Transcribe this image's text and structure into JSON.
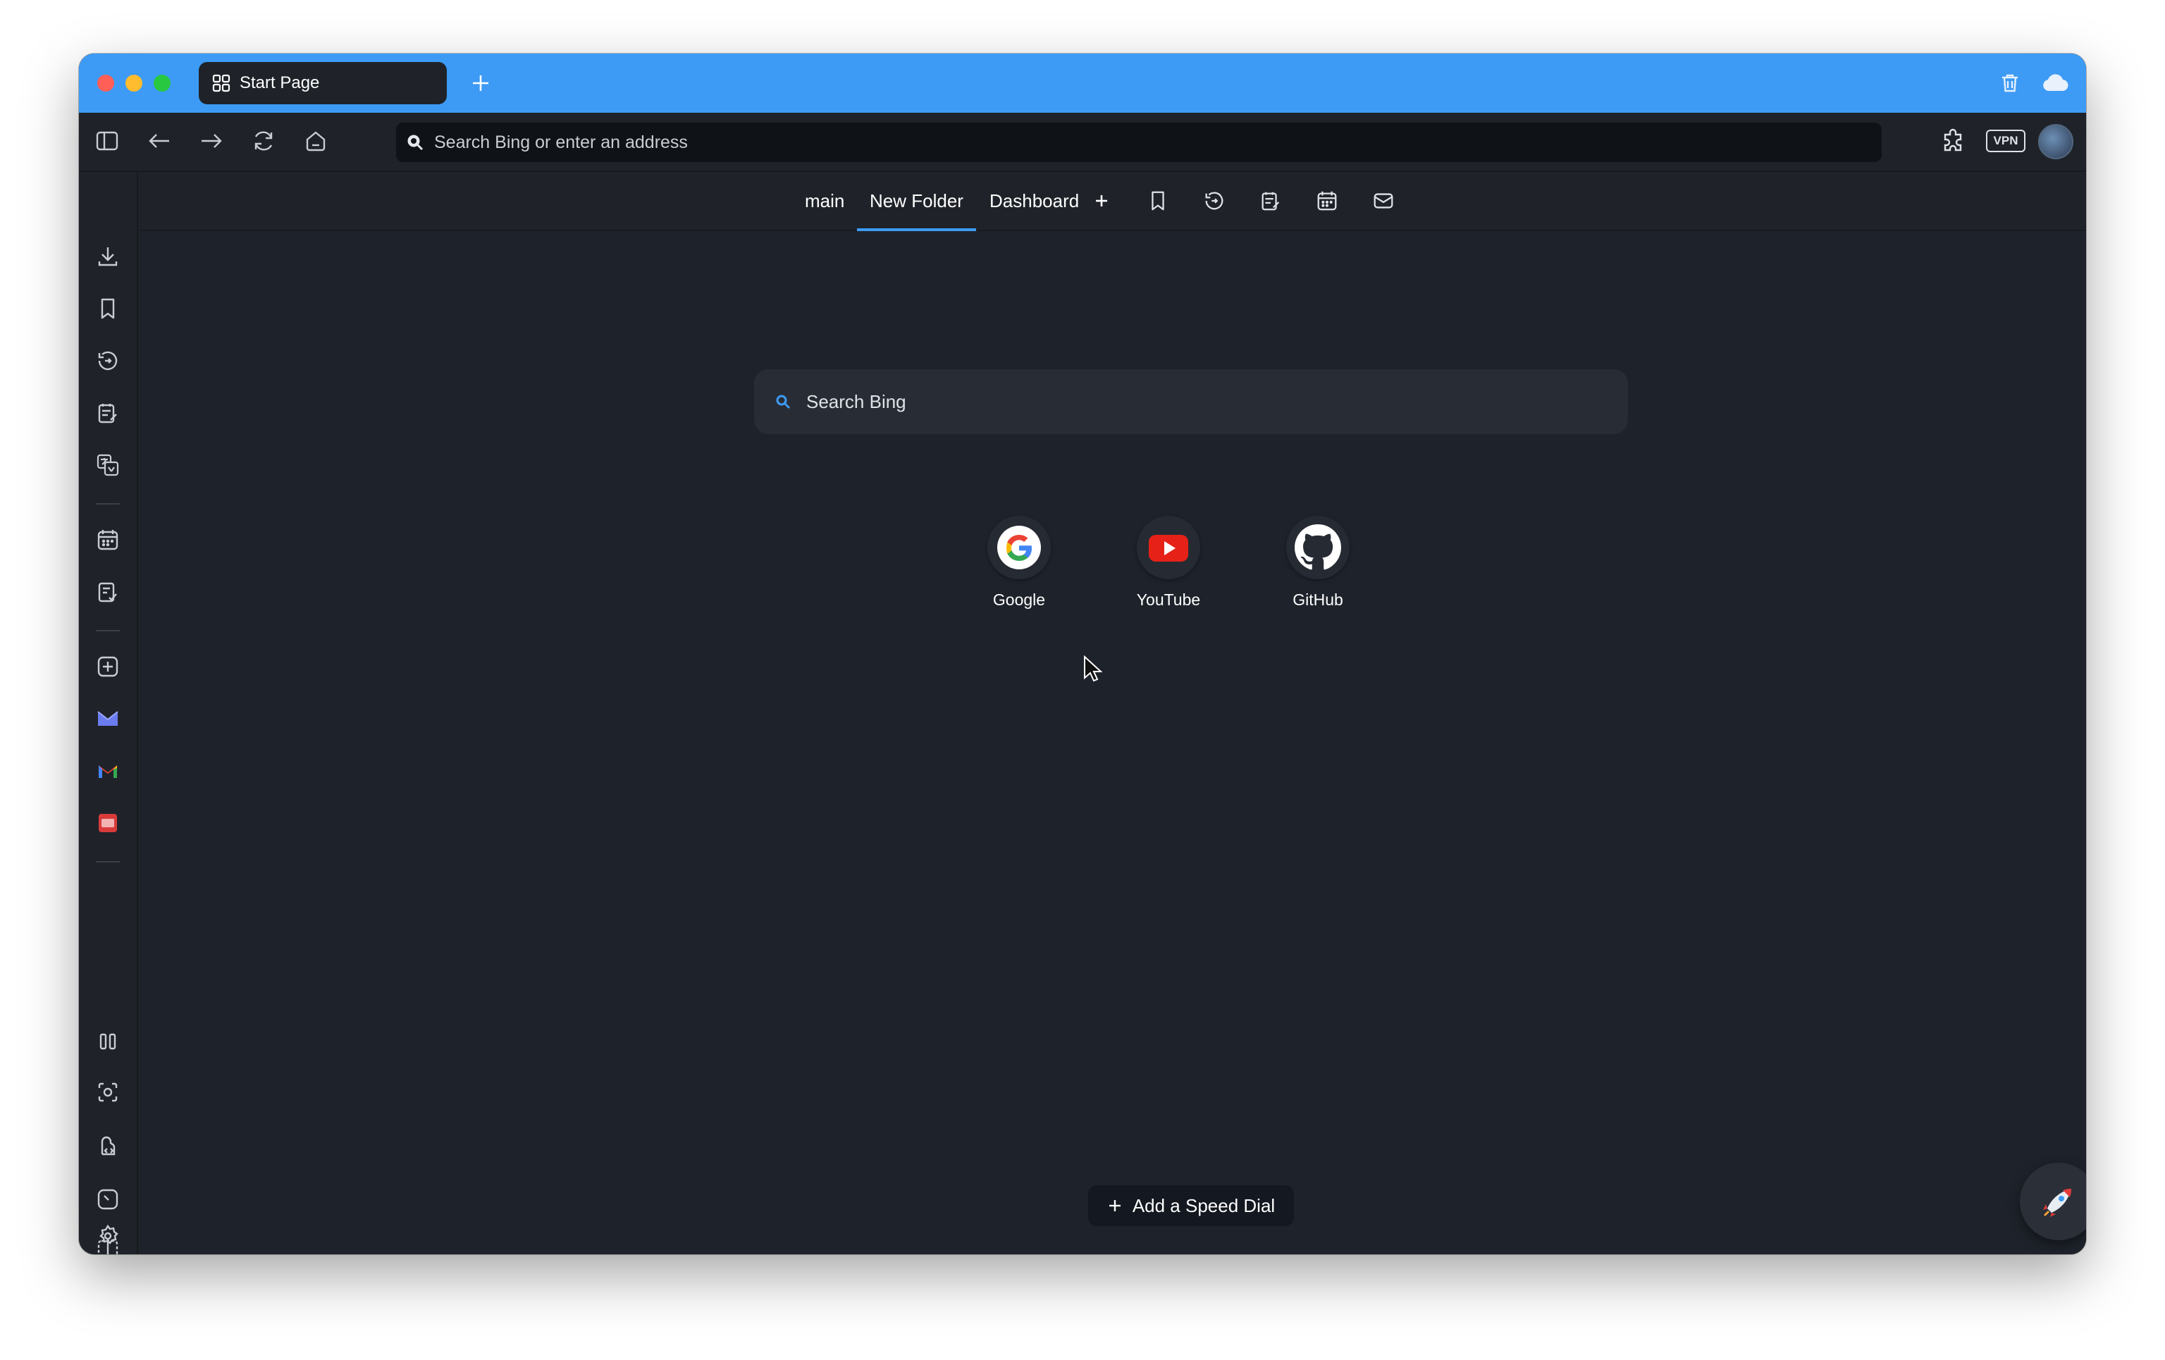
{
  "tab": {
    "title": "Start Page",
    "icon": "grid-icon"
  },
  "address_bar": {
    "placeholder": "Search Bing or enter an address",
    "icon": "search-icon"
  },
  "toolbar": {
    "left_icons": [
      "sidebar-toggle-icon",
      "back-icon",
      "forward-icon",
      "reload-icon",
      "home-icon"
    ],
    "right_icons": [
      "extensions-icon",
      "vpn-badge",
      "profile-avatar"
    ],
    "vpn_label": "VPN"
  },
  "titlebar_right_icons": [
    "trash-icon",
    "cloud-icon"
  ],
  "start_tabs": [
    {
      "label": "main",
      "active": false
    },
    {
      "label": "New Folder",
      "active": true
    },
    {
      "label": "Dashboard",
      "active": false
    }
  ],
  "start_tab_icons": [
    "add-icon",
    "bookmark-icon",
    "history-icon",
    "notes-icon",
    "calendar-icon",
    "mail-icon"
  ],
  "search": {
    "placeholder": "Search Bing"
  },
  "speed_dials": [
    {
      "label": "Google",
      "icon": "google-logo"
    },
    {
      "label": "YouTube",
      "icon": "youtube-logo"
    },
    {
      "label": "GitHub",
      "icon": "github-logo"
    }
  ],
  "add_speed_dial": {
    "label": "Add a Speed Dial"
  },
  "sidebar_panels": [
    "downloads-icon",
    "bookmarks-icon",
    "history-icon",
    "notes-icon",
    "translate-icon",
    "calendar-icon",
    "tasks-icon",
    "add-web-panel-icon",
    "mail-app-icon",
    "gmail-icon",
    "calendar-app-icon"
  ],
  "sidebar_bottom": [
    "tiling-icon",
    "capture-icon",
    "sync-icon",
    "clock-icon",
    "split-view-icon",
    "settings-icon"
  ],
  "colors": {
    "accent": "#3d9bf5",
    "background": "#1e232b",
    "toolbar": "#1f2329"
  }
}
